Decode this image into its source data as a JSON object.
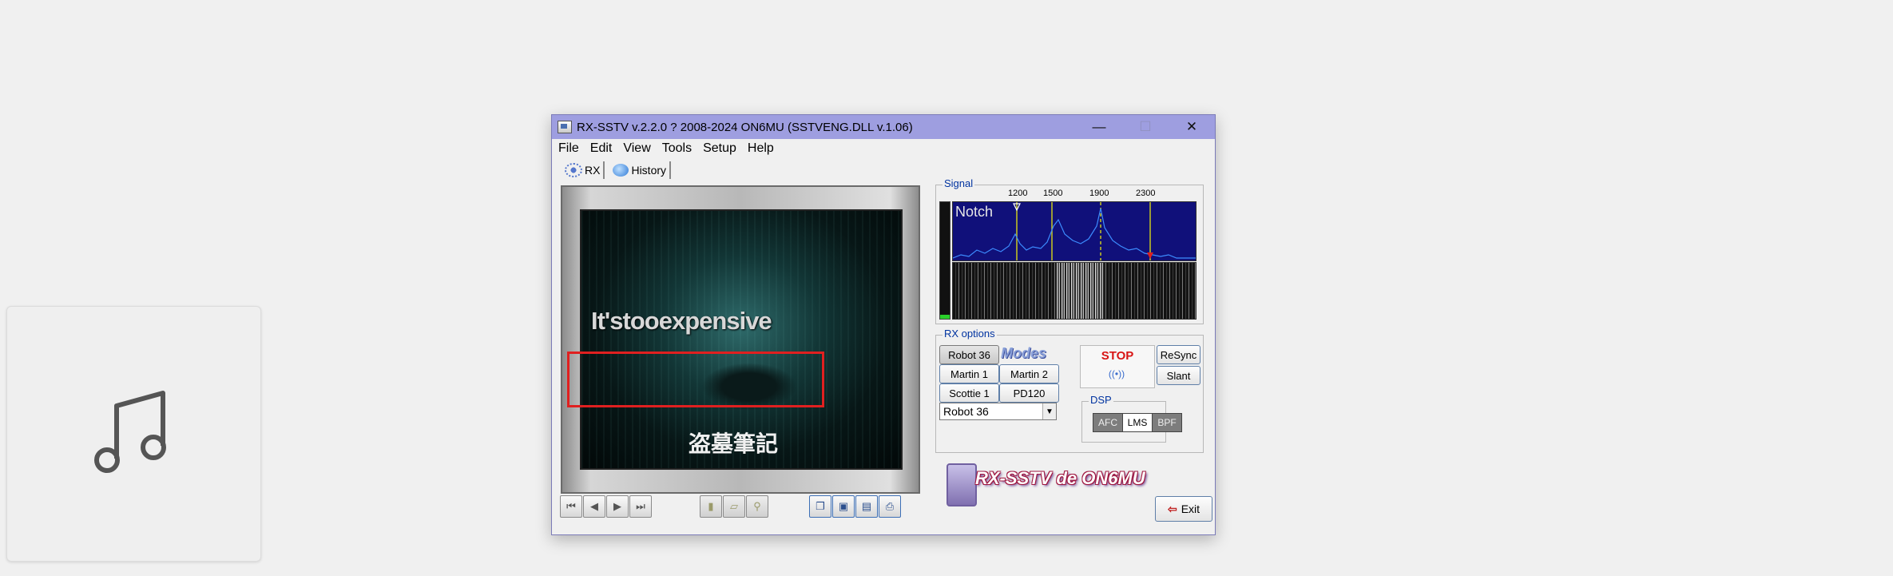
{
  "window": {
    "title": "RX-SSTV v.2.2.0 ? 2008-2024 ON6MU (SSTVENG.DLL v.1.06)",
    "controls": {
      "minimize": "—",
      "maximize": "☐",
      "close": "✕"
    }
  },
  "menu": [
    {
      "label": "File"
    },
    {
      "label": "Edit"
    },
    {
      "label": "View"
    },
    {
      "label": "Tools"
    },
    {
      "label": "Setup"
    },
    {
      "label": "Help"
    }
  ],
  "tabs": {
    "rx": "RX",
    "history": "History"
  },
  "image": {
    "overlay_text": "It'stooexpensive",
    "chinese_title": "盗墓筆記"
  },
  "signal": {
    "label": "Signal",
    "freqs": [
      "1200",
      "1500",
      "1900",
      "2300"
    ],
    "notch": "Notch"
  },
  "rx_options": {
    "label": "RX options",
    "modes_logo": "Modes",
    "modes": [
      "Robot 36",
      "Martin 1",
      "Martin 2",
      "Scottie 1",
      "PD120"
    ],
    "selected_mode": "Robot 36",
    "stop": "STOP",
    "resync": "ReSync",
    "slant": "Slant",
    "dsp_label": "DSP",
    "dsp": {
      "afc": "AFC",
      "lms": "LMS",
      "bpf": "BPF"
    }
  },
  "branding": {
    "logo_text": "RX-SSTV de ON6MU"
  },
  "exit_label": "Exit"
}
